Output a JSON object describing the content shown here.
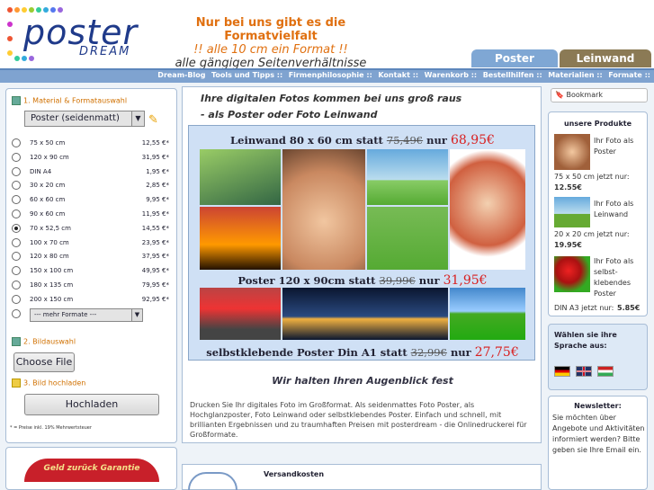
{
  "header": {
    "logo_main": "poster",
    "logo_sub": "DREAM",
    "slogan_line1": "Nur bei uns gibt es die Formatvielfalt",
    "slogan_line2": "!! alle 10 cm ein Format !!",
    "slogan_line3": "alle gängigen Seitenverhältnisse",
    "tabs": [
      "Poster",
      "Leinwand"
    ]
  },
  "nav": [
    "Dream-Blog",
    "Tools und Tipps ::",
    "Firmenphilosophie ::",
    "Kontakt ::",
    "Warenkorb ::",
    "Bestellhilfen ::",
    "Materialien ::",
    "Formate ::"
  ],
  "order": {
    "step1": "1. Material & Formatauswahl",
    "material_selected": "Poster (seidenmatt)",
    "formats": [
      {
        "name": "75 x 50 cm",
        "price": "12,55 €*",
        "selected": false
      },
      {
        "name": "120 x 90 cm",
        "price": "31,95 €*",
        "selected": false
      },
      {
        "name": "DIN A4",
        "price": "1,95 €*",
        "selected": false
      },
      {
        "name": "30 x 20 cm",
        "price": "2,85 €*",
        "selected": false
      },
      {
        "name": "60 x 60 cm",
        "price": "9,95 €*",
        "selected": false
      },
      {
        "name": "90 x 60 cm",
        "price": "11,95 €*",
        "selected": false
      },
      {
        "name": "70 x 52,5 cm",
        "price": "14,55 €*",
        "selected": true
      },
      {
        "name": "100 x 70 cm",
        "price": "23,95 €*",
        "selected": false
      },
      {
        "name": "120 x 80 cm",
        "price": "37,95 €*",
        "selected": false
      },
      {
        "name": "150 x 100 cm",
        "price": "49,95 €*",
        "selected": false
      },
      {
        "name": "180 x 135 cm",
        "price": "79,95 €*",
        "selected": false
      },
      {
        "name": "200 x 150 cm",
        "price": "92,95 €*",
        "selected": false
      }
    ],
    "more_formats": "--- mehr Formate ---",
    "step2": "2. Bildauswahl",
    "choose_file": "Choose File",
    "step3": "3. Bild hochladen",
    "upload": "Hochladen",
    "note": "* = Preise inkl. 19% Mehrwertsteuer"
  },
  "guarantee": "Geld zurück Garantie",
  "center": {
    "intro1": "Ihre digitalen Fotos kommen bei uns groß raus",
    "intro2": "- als Poster oder Foto Leinwand",
    "promo": [
      {
        "text": "Leinwand 80 x 60 cm statt",
        "old": "75,49€",
        "mid": "nur",
        "new": "68,95€"
      },
      {
        "text": "Poster 120 x 90cm statt",
        "old": "39,99€",
        "mid": "nur",
        "new": "31,95€"
      },
      {
        "text": "selbstklebende Poster Din A1 statt",
        "old": "32,99€",
        "mid": "nur",
        "new": "27,75€"
      }
    ],
    "tagline": "Wir halten Ihren Augenblick fest",
    "description": "Drucken Sie Ihr digitales Foto im Großformat. Als seidenmattes Foto Poster, als Hochglanzposter, Foto Leinwand oder selbstklebendes Poster. Einfach und schnell, mit brillianten Ergebnissen und zu traumhaften Preisen mit posterdream - die Onlinedruckerei für Großformate.",
    "shipping": "Versandkosten"
  },
  "sidebar": {
    "bookmark": "Bookmark",
    "products_title": "unsere Produkte",
    "products": [
      {
        "caption": "Ihr Foto als Poster",
        "size": "75 x 50 cm jetzt nur:",
        "price": "12.55€"
      },
      {
        "caption": "Ihr Foto als Leinwand",
        "size": "20 x 20 cm jetzt nur:",
        "price": "19.95€"
      },
      {
        "caption": "Ihr Foto als selbst-klebendes Poster",
        "size": "DIN A3 jetzt nur:",
        "price": "5.85€"
      }
    ],
    "language": "Wählen sie ihre Sprache aus:",
    "newsletter_title": "Newsletter:",
    "newsletter_text": "Sie möchten über Angebote und Aktivitäten informiert werden? Bitte geben sie Ihre Email ein."
  },
  "colors": {
    "accent_orange": "#e07010",
    "nav_blue": "#7fa3d0",
    "price_red": "#d82020"
  }
}
